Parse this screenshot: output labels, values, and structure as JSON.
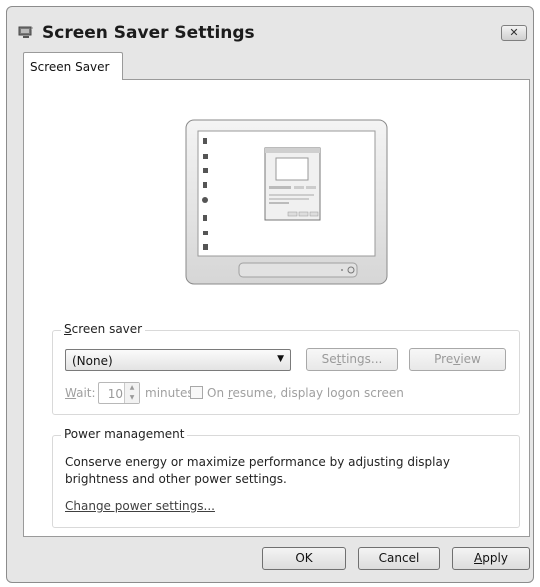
{
  "window": {
    "title": "Screen Saver Settings",
    "close_glyph": "✕",
    "icon": "screen-saver-app-icon"
  },
  "tabs": [
    {
      "label": "Screen Saver",
      "selected": true
    }
  ],
  "screen_saver": {
    "group_label_prefix": "S",
    "group_label_rest": "creen saver",
    "selected": "(None)",
    "settings_prefix": "Se",
    "settings_mnemonic": "t",
    "settings_rest": "tings...",
    "preview_prefix": "Pre",
    "preview_mnemonic": "v",
    "preview_rest": "iew",
    "wait_mnemonic": "W",
    "wait_rest": "ait:",
    "wait_value": "10",
    "minutes_label": "minutes",
    "resume_prefix": "On ",
    "resume_mnemonic": "r",
    "resume_rest": "esume, display logon screen",
    "resume_checked": false
  },
  "power": {
    "group_label": "Power management",
    "description_line1": "Conserve energy or maximize performance by adjusting display",
    "description_line2": "brightness and other power settings.",
    "link": "Change power settings..."
  },
  "buttons": {
    "ok": "OK",
    "cancel": "Cancel",
    "apply_mnemonic": "A",
    "apply_rest": "pply"
  },
  "colors": {
    "disabled_text": "#9a9a9a",
    "window_bg": "#e6e6e6"
  }
}
